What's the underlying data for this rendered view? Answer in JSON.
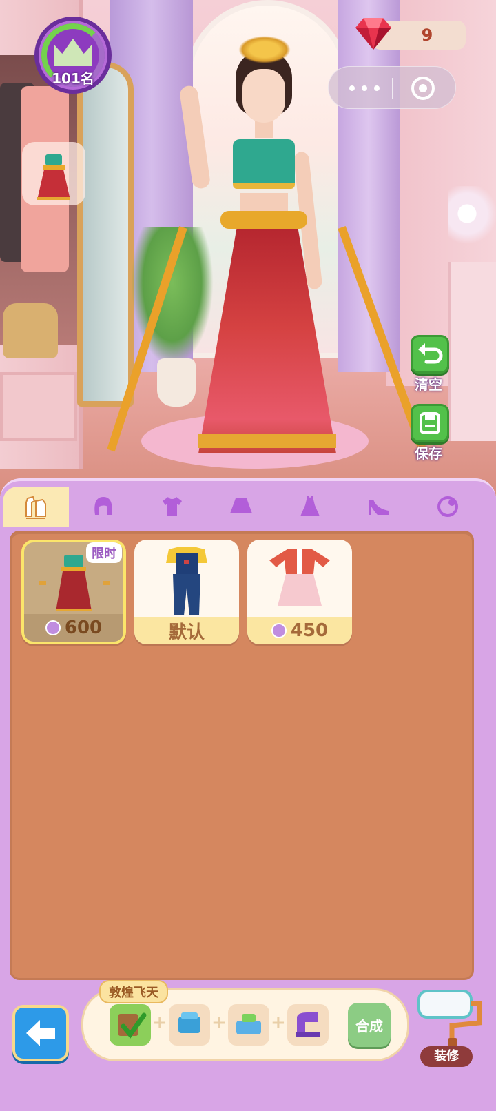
{
  "hud": {
    "rank_label": "101名",
    "gem_count": "9"
  },
  "side_buttons": {
    "clear_label": "清空",
    "save_label": "保存"
  },
  "tabs": [
    {
      "name": "outfit",
      "icon": "outfit-set-icon",
      "active": true
    },
    {
      "name": "hair",
      "icon": "hair-icon",
      "active": false
    },
    {
      "name": "top",
      "icon": "shirt-icon",
      "active": false
    },
    {
      "name": "skirt",
      "icon": "skirt-icon",
      "active": false
    },
    {
      "name": "dress",
      "icon": "dress-icon",
      "active": false
    },
    {
      "name": "shoes",
      "icon": "high-heel-icon",
      "active": false
    },
    {
      "name": "accessory",
      "icon": "accessory-icon",
      "active": false
    }
  ],
  "items": [
    {
      "price": "600",
      "badge": "限时",
      "selected": true
    },
    {
      "label": "默认"
    },
    {
      "price": "450"
    }
  ],
  "craft": {
    "title": "敦煌飞天",
    "synth_label": "合成"
  },
  "bottom": {
    "decorate_label": "装修"
  },
  "colors": {
    "panel": "#d8a5e6",
    "grid_bg": "#d5875f",
    "accent_green": "#53c14a",
    "back_blue": "#2d9ae8"
  }
}
